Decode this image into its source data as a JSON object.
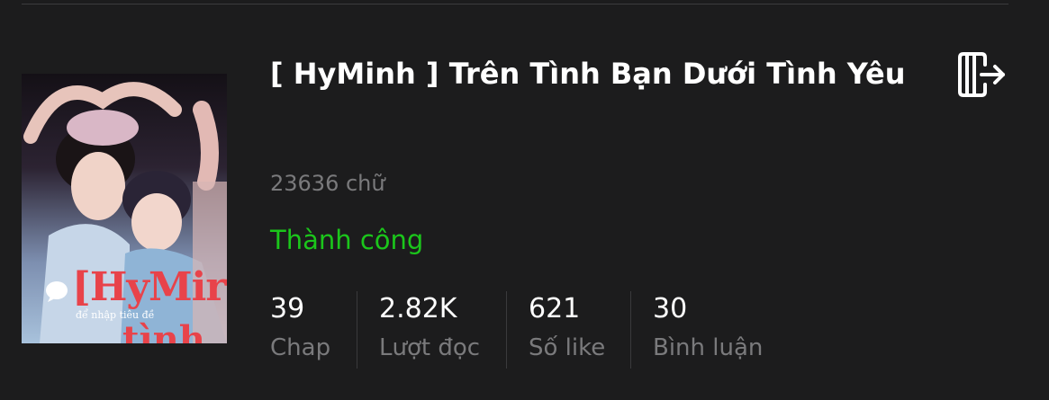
{
  "story": {
    "title": "[ HyMinh ] Trên Tình Bạn Dưới Tình Yêu",
    "word_count": "23636 chữ",
    "status": "Thành công",
    "status_color": "#1bc61b"
  },
  "cover": {
    "title_text": "[HyMir",
    "subtitle_text": "để nhập tiêu đề",
    "bottom_text": "tình"
  },
  "stats": [
    {
      "value": "39",
      "label": "Chap"
    },
    {
      "value": "2.82K",
      "label": "Lượt đọc"
    },
    {
      "value": "621",
      "label": "Số like"
    },
    {
      "value": "30",
      "label": "Bình luận"
    }
  ],
  "icons": {
    "exit": "exit-icon",
    "comment": "speech-bubble-icon"
  }
}
